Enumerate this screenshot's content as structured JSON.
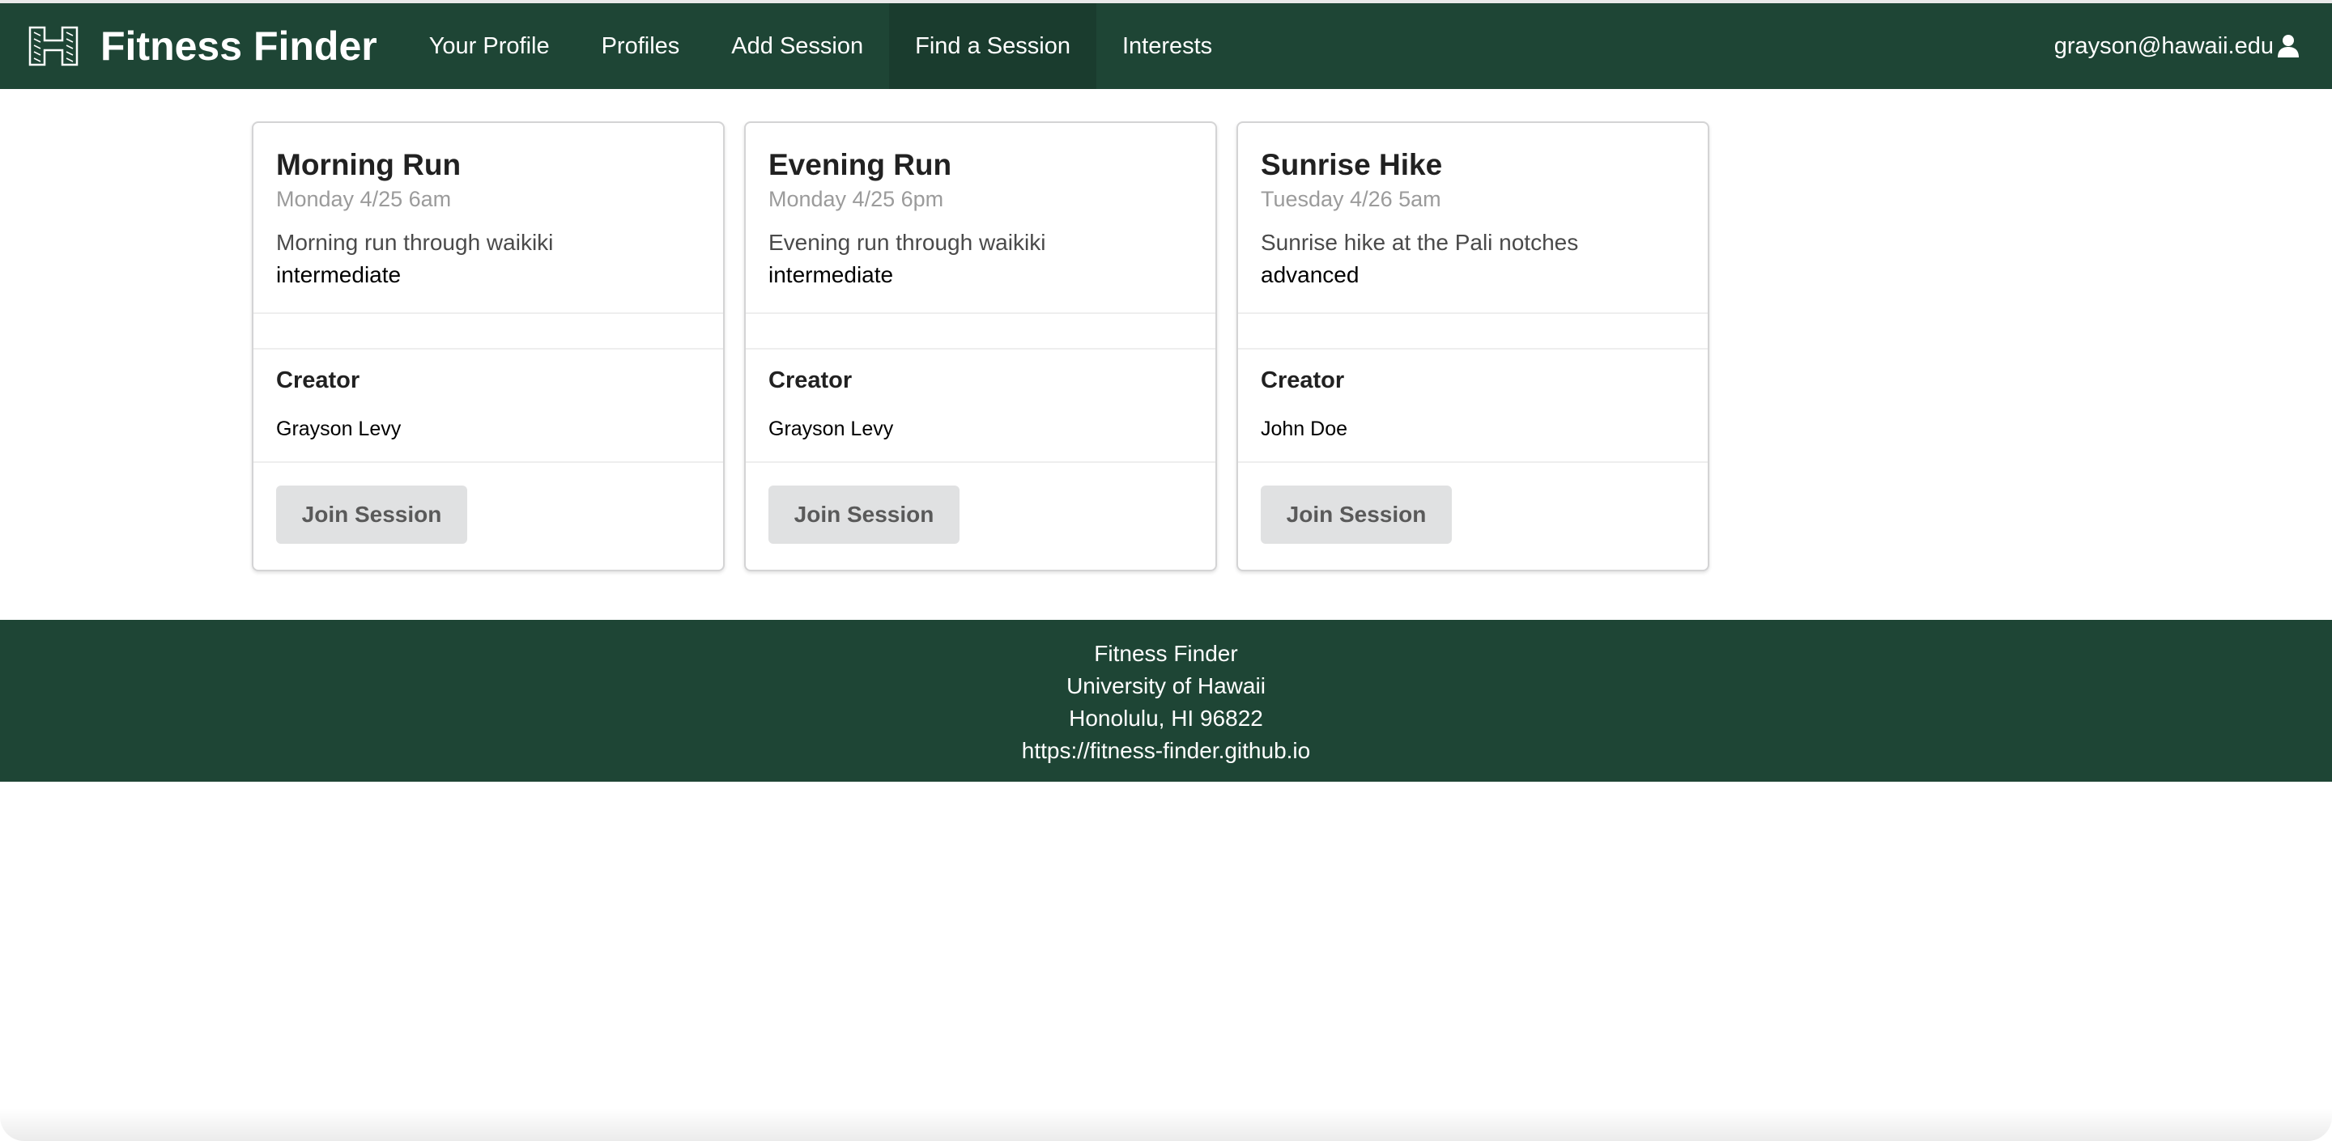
{
  "navbar": {
    "brand": "Fitness Finder",
    "logo_icon": "hawaii-h-logo",
    "items": [
      {
        "label": "Your Profile",
        "active": false
      },
      {
        "label": "Profiles",
        "active": false
      },
      {
        "label": "Add Session",
        "active": false
      },
      {
        "label": "Find a Session",
        "active": true
      },
      {
        "label": "Interests",
        "active": false
      }
    ],
    "user": "grayson@hawaii.edu",
    "user_icon": "user-icon"
  },
  "sessions": [
    {
      "title": "Morning Run",
      "date": "Monday 4/25 6am",
      "description": "Morning run through waikiki",
      "level": "intermediate",
      "creator_label": "Creator",
      "creator": "Grayson Levy",
      "join_label": "Join Session"
    },
    {
      "title": "Evening Run",
      "date": "Monday 4/25 6pm",
      "description": "Evening run through waikiki",
      "level": "intermediate",
      "creator_label": "Creator",
      "creator": "Grayson Levy",
      "join_label": "Join Session"
    },
    {
      "title": "Sunrise Hike",
      "date": "Tuesday 4/26 5am",
      "description": "Sunrise hike at the Pali notches",
      "level": "advanced",
      "creator_label": "Creator",
      "creator": "John Doe",
      "join_label": "Join Session"
    }
  ],
  "footer": {
    "line1": "Fitness Finder",
    "line2": "University of Hawaii",
    "line3": "Honolulu, HI 96822",
    "line4": "https://fitness-finder.github.io"
  },
  "colors": {
    "brand_green": "#1e4535",
    "button_gray": "#e0e1e2"
  }
}
